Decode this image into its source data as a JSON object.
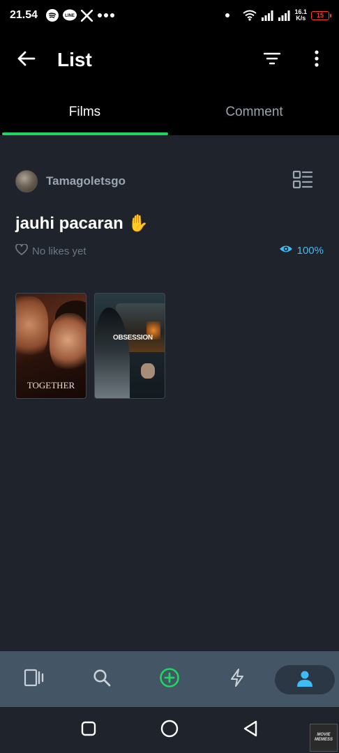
{
  "status_bar": {
    "time": "21.54",
    "net_speed_value": "16.1",
    "net_speed_unit": "K/s",
    "battery": "15",
    "icons": [
      "spotify-icon",
      "line-icon",
      "x-icon",
      "more-dots-icon",
      "dot-icon",
      "wifi-icon",
      "signal-icon",
      "signal-icon",
      "battery-icon"
    ]
  },
  "app_bar": {
    "title": "List",
    "icons": [
      "back-arrow-icon",
      "filter-icon",
      "more-vert-icon"
    ]
  },
  "tabs": [
    {
      "label": "Films",
      "active": true
    },
    {
      "label": "Comment",
      "active": false
    }
  ],
  "list": {
    "owner": "Tamagoletsgo",
    "title": "jauhi pacaran ✋",
    "likes": "No likes yet",
    "views": "100%"
  },
  "films": [
    {
      "title": "TOGETHER"
    },
    {
      "title": "OBSESSION"
    }
  ],
  "bottom_nav": {
    "items": [
      "film-icon",
      "search-icon",
      "add-circle-icon",
      "activity-bolt-icon",
      "profile-icon"
    ],
    "active": "profile-icon"
  },
  "watermark": {
    "line1": "MOVIE",
    "line2": "MEMESS"
  },
  "colors": {
    "background": "#1f242c",
    "accent_green": "#1ed760",
    "accent_blue": "#40bcf4",
    "nav_background": "#445566",
    "battery_low": "#ff3b30"
  }
}
